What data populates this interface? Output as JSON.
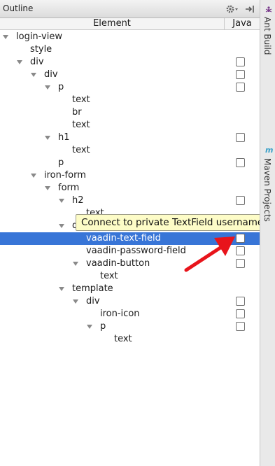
{
  "panel": {
    "title": "Outline",
    "icons": {
      "settings": "gear-icon",
      "hide": "hide-panel-icon"
    },
    "columns": {
      "element": "Element",
      "java": "Java"
    }
  },
  "tree": [
    {
      "label": "login-view",
      "expanded": true,
      "checkbox": false
    },
    {
      "label": "style",
      "checkbox": false
    },
    {
      "label": "div",
      "expanded": true,
      "checkbox": true,
      "checked": false
    },
    {
      "label": "div",
      "expanded": true,
      "checkbox": true,
      "checked": false
    },
    {
      "label": "p",
      "expanded": true,
      "checkbox": true,
      "checked": false
    },
    {
      "label": "text",
      "checkbox": false
    },
    {
      "label": "br",
      "checkbox": false
    },
    {
      "label": "text",
      "checkbox": false
    },
    {
      "label": "h1",
      "expanded": true,
      "checkbox": true,
      "checked": false
    },
    {
      "label": "text",
      "checkbox": false
    },
    {
      "label": "p",
      "checkbox": true,
      "checked": false
    },
    {
      "label": "iron-form",
      "expanded": true,
      "checkbox": false
    },
    {
      "label": "form",
      "expanded": true,
      "checkbox": false
    },
    {
      "label": "h2",
      "expanded": true,
      "checkbox": true,
      "checked": false
    },
    {
      "label": "text",
      "checkbox": false
    },
    {
      "label": "div",
      "expanded": true,
      "checkbox": false
    },
    {
      "label": "vaadin-text-field",
      "checkbox": true,
      "checked": false,
      "selected": true
    },
    {
      "label": "vaadin-password-field",
      "checkbox": true,
      "checked": false
    },
    {
      "label": "vaadin-button",
      "expanded": true,
      "checkbox": true,
      "checked": false
    },
    {
      "label": "text",
      "checkbox": false
    },
    {
      "label": "template",
      "expanded": true,
      "checkbox": false
    },
    {
      "label": "div",
      "expanded": true,
      "checkbox": true,
      "checked": false
    },
    {
      "label": "iron-icon",
      "checkbox": true,
      "checked": false
    },
    {
      "label": "p",
      "expanded": true,
      "checkbox": true,
      "checked": false
    },
    {
      "label": "text",
      "checkbox": false
    }
  ],
  "tooltip": {
    "text": "Connect to private TextField username"
  },
  "sidebar": {
    "tabs": [
      {
        "label": "Ant Build",
        "icon": "ant-icon"
      },
      {
        "label": "Maven Projects",
        "icon": "maven-icon",
        "icon_text": "m"
      }
    ]
  },
  "colors": {
    "selection": "#3875d7",
    "tooltip_bg": "#fdfcc7",
    "arrow": "#e8141b"
  }
}
